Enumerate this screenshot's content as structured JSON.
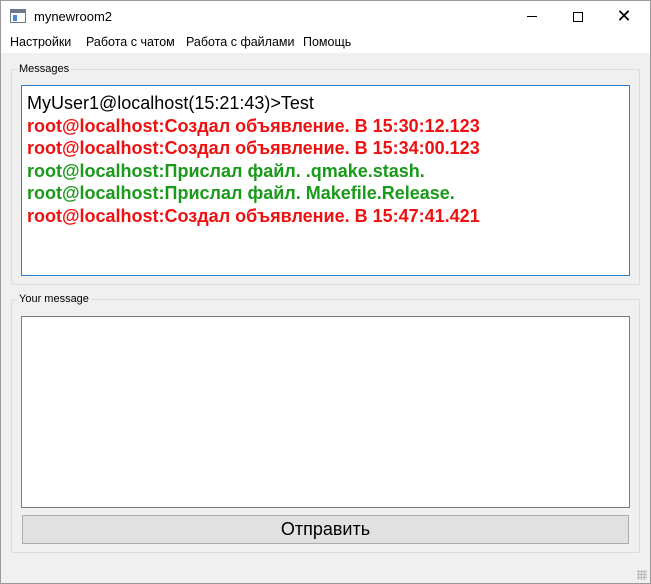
{
  "window": {
    "title": "mynewroom2"
  },
  "menu": {
    "items": [
      {
        "label": "Настройки"
      },
      {
        "label": "Работа с чатом"
      },
      {
        "label": "Работа с файлами"
      },
      {
        "label": "Помощь"
      }
    ]
  },
  "messages_group": {
    "title": "Messages",
    "lines": [
      {
        "text": "MyUser1@localhost(15:21:43)>Test",
        "color": "#000000",
        "bold": false
      },
      {
        "text": "root@localhost:Создал объявление. В 15:30:12.123",
        "color": "#ee1111",
        "bold": true
      },
      {
        "text": "root@localhost:Создал объявление. В 15:34:00.123",
        "color": "#ee1111",
        "bold": true
      },
      {
        "text": "root@localhost:Прислал файл. .qmake.stash.",
        "color": "#1a9a1a",
        "bold": true
      },
      {
        "text": "root@localhost:Прислал файл. Makefile.Release.",
        "color": "#1a9a1a",
        "bold": true
      },
      {
        "text": "root@localhost:Создал объявление. В 15:47:41.421",
        "color": "#ee1111",
        "bold": true
      }
    ]
  },
  "your_message_group": {
    "title": "Your message",
    "input_value": ""
  },
  "send_button": {
    "label": "Отправить"
  }
}
